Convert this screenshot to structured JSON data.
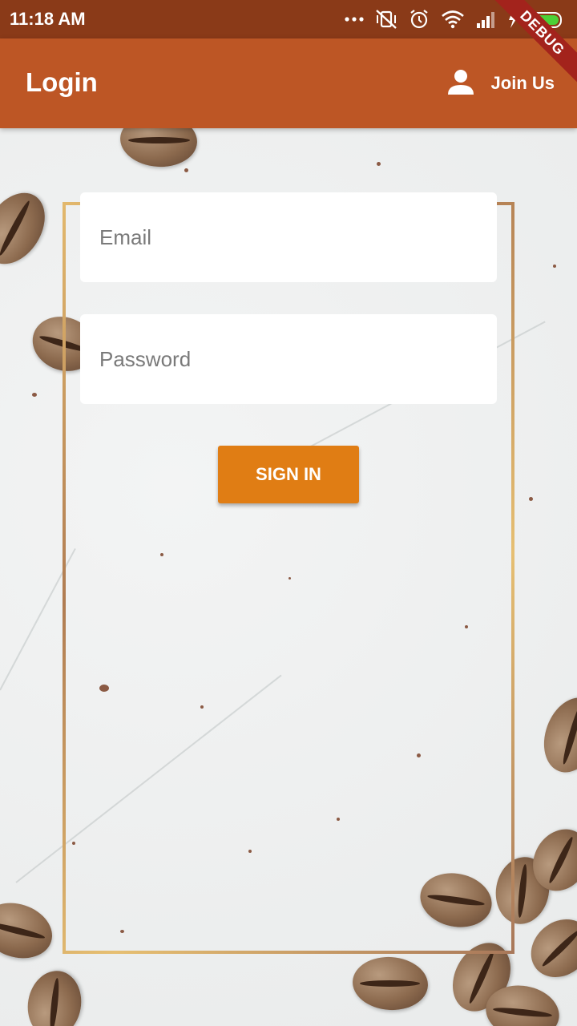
{
  "status_bar": {
    "time": "11:18 AM",
    "icons": [
      "more-dots-icon",
      "vibrate-off-icon",
      "alarm-icon",
      "wifi-icon",
      "signal-icon",
      "charging-battery-icon"
    ]
  },
  "debug_banner": "DEBUG",
  "app_bar": {
    "title": "Login",
    "join_us_label": "Join Us",
    "join_us_icon": "person-icon"
  },
  "form": {
    "email_placeholder": "Email",
    "email_value": "",
    "password_placeholder": "Password",
    "password_value": "",
    "sign_in_label": "SIGN IN"
  },
  "colors": {
    "status_bar": "#8a3a18",
    "app_bar": "#bd5625",
    "button": "#e07d14",
    "frame_gold": "#d4a760"
  }
}
